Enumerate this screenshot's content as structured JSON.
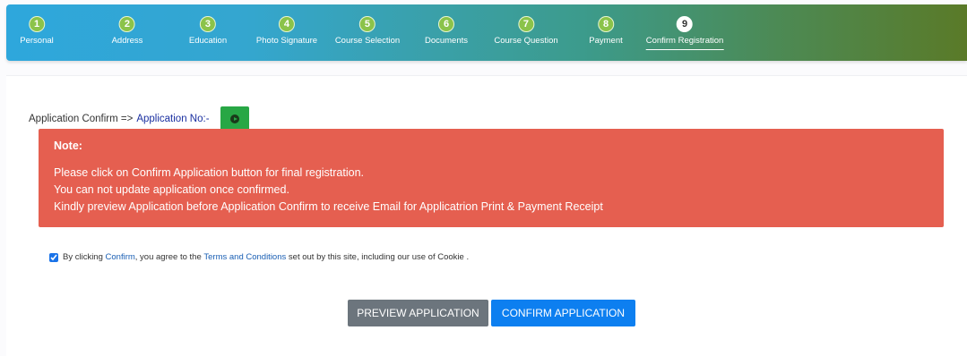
{
  "stepper": {
    "steps": [
      {
        "num": "1",
        "label": "Personal"
      },
      {
        "num": "2",
        "label": "Address"
      },
      {
        "num": "3",
        "label": "Education"
      },
      {
        "num": "4",
        "label": "Photo Signature"
      },
      {
        "num": "5",
        "label": "Course Selection"
      },
      {
        "num": "6",
        "label": "Documents"
      },
      {
        "num": "7",
        "label": "Course Question"
      },
      {
        "num": "8",
        "label": "Payment"
      },
      {
        "num": "9",
        "label": "Confirm Registration"
      }
    ],
    "active_step": 9
  },
  "application": {
    "confirm_label": "Application Confirm =>",
    "number_label": "Application No:-",
    "play_icon": "play-circle-icon"
  },
  "note": {
    "title": "Note:",
    "lines": [
      "Please click on Confirm Application button for final registration.",
      "You can not update application once confirmed.",
      "Kindly preview Application before Application Confirm to receive Email for Applicatrion Print & Payment Receipt"
    ],
    "color": "#e55f50"
  },
  "agreement": {
    "checked": true,
    "prefix": "By clicking",
    "confirm_link": "Confirm",
    "middle": ", you agree to the",
    "terms_link": "Terms and Conditions",
    "suffix": "set out by this site, including our use of Cookie ."
  },
  "buttons": {
    "preview_label": "PREVIEW APPLICATION",
    "confirm_label": "CONFIRM APPLICATION"
  },
  "colors": {
    "step_done": "#8bc34a",
    "play_button": "#28a745",
    "preview_button": "#6c757d",
    "confirm_button": "#0d7ff0"
  }
}
